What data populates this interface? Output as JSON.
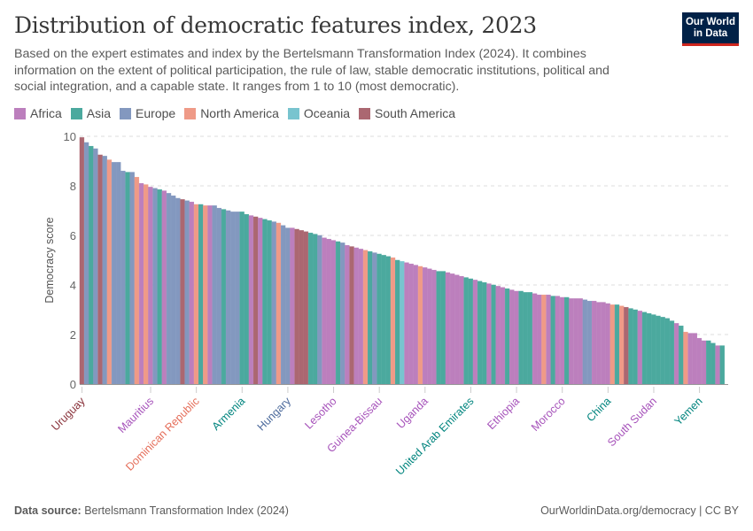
{
  "header": {
    "title": "Distribution of democratic features index, 2023",
    "subtitle": "Based on the expert estimates and index by the Bertelsmann Transformation Index (2024). It combines information on the extent of political participation, the rule of law, stable democratic institutions, political and social integration, and a capable state. It ranges from 1 to 10 (most democratic).",
    "logo_line1": "Our World",
    "logo_line2": "in Data"
  },
  "footer": {
    "source_label": "Data source:",
    "source_text": "Bertelsmann Transformation Index (2024)",
    "right_text": "OurWorldinData.org/democracy | CC BY"
  },
  "chart_data": {
    "type": "bar",
    "title": "Distribution of democratic features index, 2023",
    "xlabel": "",
    "ylabel": "Democracy score",
    "ylim": [
      0,
      10
    ],
    "yticks": [
      0,
      2,
      4,
      6,
      8,
      10
    ],
    "grid": true,
    "legend_position": "top-left",
    "legend": [
      {
        "key": "AF",
        "label": "Africa",
        "color": "#bc7fbd"
      },
      {
        "key": "AS",
        "label": "Asia",
        "color": "#4ba99e"
      },
      {
        "key": "EU",
        "label": "Europe",
        "color": "#8398bf"
      },
      {
        "key": "NA",
        "label": "North America",
        "color": "#ef9a87"
      },
      {
        "key": "OC",
        "label": "Oceania",
        "color": "#78c4cf"
      },
      {
        "key": "SA",
        "label": "South America",
        "color": "#ab6771"
      }
    ],
    "label_colors": {
      "AF": "#a652ba",
      "AS": "#00847e",
      "EU": "#4c6a9c",
      "NA": "#e56e5a",
      "OC": "#38aaba",
      "SA": "#883039"
    },
    "labeled_categories": [
      {
        "index": 0,
        "label": "Uruguay",
        "region": "SA"
      },
      {
        "index": 15,
        "label": "Mauritius",
        "region": "AF"
      },
      {
        "index": 25,
        "label": "Dominican Republic",
        "region": "NA"
      },
      {
        "index": 35,
        "label": "Armenia",
        "region": "AS"
      },
      {
        "index": 45,
        "label": "Hungary",
        "region": "EU"
      },
      {
        "index": 55,
        "label": "Lesotho",
        "region": "AF"
      },
      {
        "index": 65,
        "label": "Guinea-Bissau",
        "region": "AF"
      },
      {
        "index": 75,
        "label": "Uganda",
        "region": "AF"
      },
      {
        "index": 85,
        "label": "United Arab Emirates",
        "region": "AS"
      },
      {
        "index": 95,
        "label": "Ethiopia",
        "region": "AF"
      },
      {
        "index": 105,
        "label": "Morocco",
        "region": "AF"
      },
      {
        "index": 115,
        "label": "China",
        "region": "AS"
      },
      {
        "index": 125,
        "label": "South Sudan",
        "region": "AF"
      },
      {
        "index": 135,
        "label": "Yemen",
        "region": "AS"
      }
    ],
    "regions": [
      "SA",
      "EU",
      "AS",
      "EU",
      "SA",
      "EU",
      "NA",
      "EU",
      "EU",
      "EU",
      "AS",
      "EU",
      "NA",
      "AF",
      "NA",
      "AF",
      "EU",
      "AS",
      "AF",
      "EU",
      "EU",
      "EU",
      "SA",
      "EU",
      "AF",
      "NA",
      "AS",
      "NA",
      "AF",
      "EU",
      "EU",
      "AS",
      "EU",
      "EU",
      "EU",
      "AS",
      "AS",
      "AF",
      "SA",
      "AF",
      "AS",
      "AS",
      "EU",
      "NA",
      "EU",
      "EU",
      "AF",
      "SA",
      "SA",
      "SA",
      "AS",
      "AS",
      "EU",
      "AF",
      "AF",
      "AF",
      "AS",
      "EU",
      "AF",
      "SA",
      "AF",
      "AF",
      "NA",
      "AS",
      "EU",
      "AS",
      "AS",
      "AS",
      "NA",
      "AS",
      "OC",
      "AF",
      "AF",
      "AF",
      "NA",
      "AF",
      "AF",
      "AF",
      "AS",
      "AS",
      "AF",
      "AF",
      "AF",
      "AF",
      "AS",
      "AS",
      "AF",
      "AS",
      "AS",
      "AF",
      "AS",
      "AF",
      "AF",
      "AS",
      "AF",
      "AF",
      "AS",
      "AS",
      "AS",
      "AF",
      "AF",
      "NA",
      "AF",
      "AS",
      "AF",
      "AF",
      "AS",
      "AF",
      "AF",
      "AF",
      "EU",
      "EU",
      "AF",
      "AF",
      "AF",
      "AF",
      "NA",
      "AS",
      "NA",
      "SA",
      "AS",
      "AS",
      "AF",
      "AS",
      "AS",
      "AS",
      "AS",
      "AS",
      "AS",
      "AS",
      "AF",
      "AS",
      "NA",
      "AF",
      "AF",
      "AF",
      "AF",
      "AS",
      "AS",
      "AF",
      "AS"
    ],
    "values": [
      9.95,
      9.75,
      9.6,
      9.5,
      9.25,
      9.2,
      9.05,
      8.95,
      8.95,
      8.6,
      8.55,
      8.55,
      8.35,
      8.1,
      8.05,
      7.95,
      7.9,
      7.85,
      7.8,
      7.7,
      7.6,
      7.5,
      7.45,
      7.4,
      7.35,
      7.25,
      7.25,
      7.2,
      7.2,
      7.2,
      7.1,
      7.05,
      7.0,
      6.95,
      6.95,
      6.95,
      6.85,
      6.8,
      6.75,
      6.7,
      6.65,
      6.6,
      6.55,
      6.5,
      6.4,
      6.3,
      6.3,
      6.25,
      6.2,
      6.15,
      6.1,
      6.05,
      6.0,
      5.9,
      5.85,
      5.8,
      5.75,
      5.7,
      5.6,
      5.55,
      5.5,
      5.45,
      5.4,
      5.35,
      5.3,
      5.25,
      5.2,
      5.15,
      5.1,
      5.0,
      4.95,
      4.9,
      4.85,
      4.8,
      4.75,
      4.7,
      4.65,
      4.6,
      4.55,
      4.55,
      4.5,
      4.45,
      4.4,
      4.35,
      4.3,
      4.25,
      4.2,
      4.15,
      4.1,
      4.05,
      4.0,
      3.95,
      3.9,
      3.85,
      3.8,
      3.75,
      3.75,
      3.7,
      3.7,
      3.65,
      3.6,
      3.6,
      3.6,
      3.55,
      3.55,
      3.5,
      3.5,
      3.45,
      3.45,
      3.45,
      3.4,
      3.35,
      3.35,
      3.3,
      3.3,
      3.25,
      3.2,
      3.2,
      3.15,
      3.1,
      3.05,
      3.0,
      2.95,
      2.9,
      2.85,
      2.8,
      2.75,
      2.7,
      2.65,
      2.55,
      2.45,
      2.35,
      2.1,
      2.05,
      2.05,
      1.85,
      1.75,
      1.75,
      1.65,
      1.55,
      1.55
    ]
  }
}
